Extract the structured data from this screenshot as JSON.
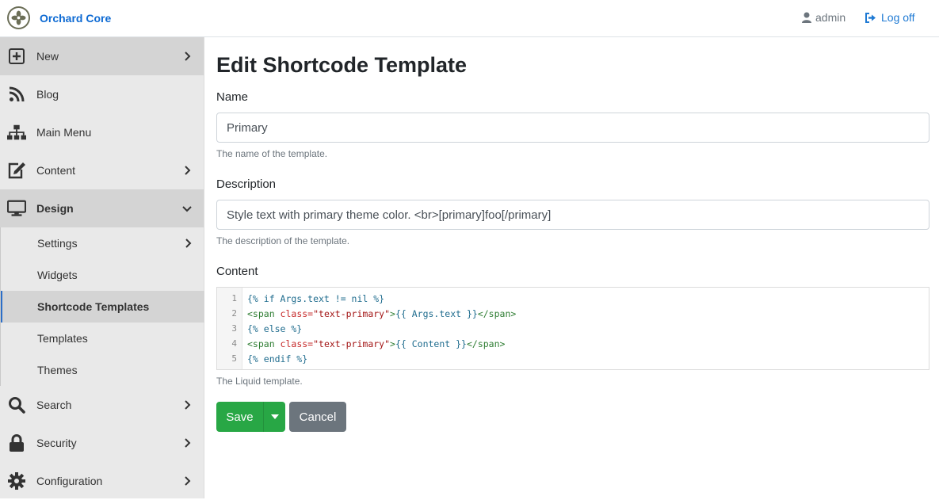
{
  "header": {
    "brand": "Orchard Core",
    "user": "admin",
    "logoff": "Log off"
  },
  "sidebar": {
    "items": [
      {
        "label": "New",
        "icon": "plus-square-icon"
      },
      {
        "label": "Blog",
        "icon": "rss-icon"
      },
      {
        "label": "Main Menu",
        "icon": "sitemap-icon"
      },
      {
        "label": "Content",
        "icon": "edit-icon"
      },
      {
        "label": "Design",
        "icon": "desktop-icon"
      },
      {
        "label": "Search",
        "icon": "search-icon"
      },
      {
        "label": "Security",
        "icon": "lock-icon"
      },
      {
        "label": "Configuration",
        "icon": "gear-icon"
      }
    ],
    "design_sub": [
      {
        "label": "Settings"
      },
      {
        "label": "Widgets"
      },
      {
        "label": "Shortcode Templates"
      },
      {
        "label": "Templates"
      },
      {
        "label": "Themes"
      }
    ]
  },
  "page": {
    "title": "Edit Shortcode Template",
    "name_label": "Name",
    "name_value": "Primary",
    "name_hint": "The name of the template.",
    "description_label": "Description",
    "description_value": "Style text with primary theme color. <br>[primary]foo[/primary]",
    "description_hint": "The description of the template.",
    "content_label": "Content",
    "content_hint": "The Liquid template.",
    "line_numbers": [
      "1",
      "2",
      "3",
      "4",
      "5"
    ],
    "code": {
      "l1": "{% if Args.text != nil %}",
      "l2_open": "<span ",
      "l2_attr": "class=",
      "l2_val": "\"text-primary\"",
      "l2_gt": ">",
      "l2_liq": "{{ Args.text }}",
      "l2_close": "</span>",
      "l3": "{% else %}",
      "l4_open": "<span ",
      "l4_attr": "class=",
      "l4_val": "\"text-primary\"",
      "l4_gt": ">",
      "l4_liq": "{{ Content }}",
      "l4_close": "</span>",
      "l5": "{% endif %}"
    },
    "save_label": "Save",
    "cancel_label": "Cancel"
  }
}
